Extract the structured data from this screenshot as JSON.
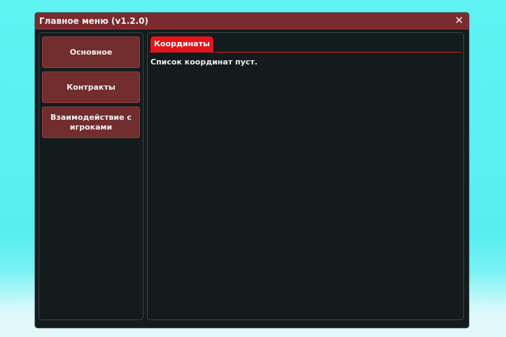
{
  "window": {
    "title": "Главное меню (v1.2.0)",
    "close_symbol": "✕"
  },
  "sidebar": {
    "items": [
      {
        "label": "Основное"
      },
      {
        "label": "Контракты"
      },
      {
        "label": "Взаимодействие с игроками"
      }
    ]
  },
  "main": {
    "tabs": [
      {
        "label": "Координаты",
        "active": true
      }
    ],
    "empty_message": "Список координат пуст."
  },
  "colors": {
    "titlebar": "#7a2b2d",
    "panel_bg": "#141b1d",
    "nav_button": "#722d2f",
    "active_tab": "#e3141a",
    "background": "#5ef2f3"
  }
}
